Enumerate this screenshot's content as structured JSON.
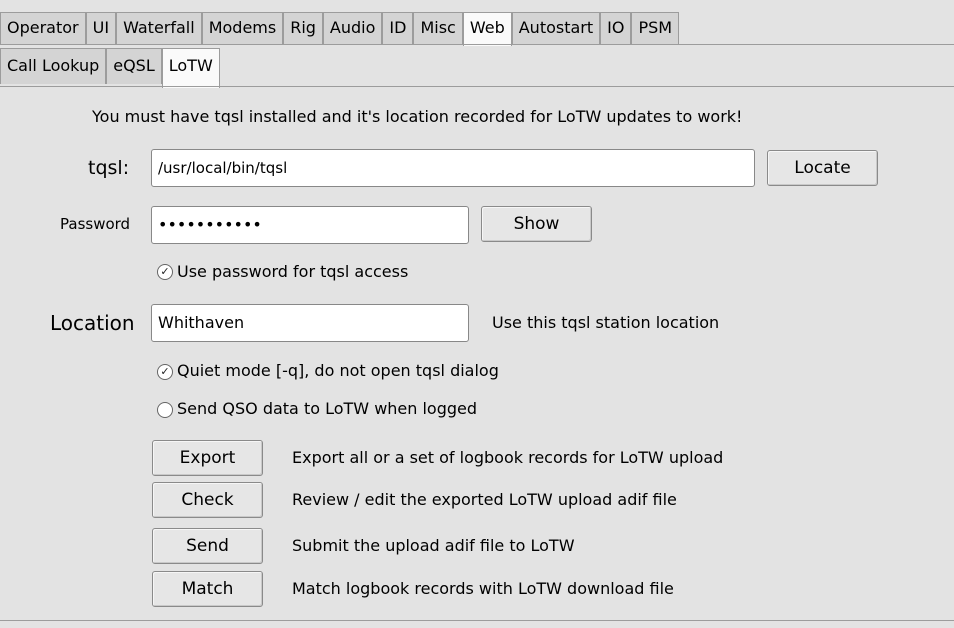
{
  "tabs": [
    {
      "label": "Operator"
    },
    {
      "label": "UI"
    },
    {
      "label": "Waterfall"
    },
    {
      "label": "Modems"
    },
    {
      "label": "Rig"
    },
    {
      "label": "Audio"
    },
    {
      "label": "ID"
    },
    {
      "label": "Misc"
    },
    {
      "label": "Web",
      "active": true
    },
    {
      "label": "Autostart"
    },
    {
      "label": "IO"
    },
    {
      "label": "PSM"
    }
  ],
  "subtabs": [
    {
      "label": "Call Lookup"
    },
    {
      "label": "eQSL"
    },
    {
      "label": "LoTW",
      "active": true
    }
  ],
  "lotw": {
    "notice": "You must have tqsl installed and it's location recorded for LoTW updates to work!",
    "tqsl_label": "tqsl:",
    "tqsl_path": "/usr/local/bin/tqsl",
    "locate_label": "Locate",
    "password_label": "Password",
    "password_value": "•••••••••••",
    "show_label": "Show",
    "use_password_label": "Use password for tqsl access",
    "use_password_checked": true,
    "location_label": "Location",
    "location_value": "Whithaven",
    "location_hint": "Use this tqsl station location",
    "quiet_label": "Quiet mode [-q], do not open tqsl dialog",
    "quiet_checked": true,
    "send_logged_label": "Send QSO data to LoTW when logged",
    "send_logged_checked": false,
    "actions": [
      {
        "button": "Export",
        "desc": "Export all or a set of logbook records for LoTW upload"
      },
      {
        "button": "Check",
        "desc": "Review / edit the exported LoTW upload adif file"
      },
      {
        "button": "Send",
        "desc": "Submit the upload adif file to LoTW"
      },
      {
        "button": "Match",
        "desc": "Match logbook records with LoTW download file"
      }
    ]
  }
}
